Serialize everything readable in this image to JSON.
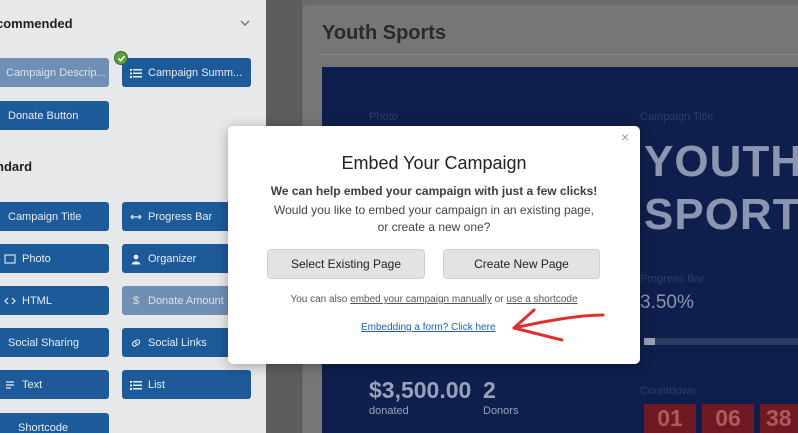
{
  "sidebar": {
    "recommended_label": "commended",
    "standard_label": "ndard",
    "recommended_items": [
      {
        "label": "Campaign Descrip...",
        "icon": "text-icon",
        "disabled": true
      },
      {
        "label": "Campaign Summ...",
        "icon": "list-icon",
        "disabled": false
      },
      {
        "label": "Donate Button",
        "icon": "button-icon",
        "disabled": false
      }
    ],
    "standard_items": [
      {
        "label": "Campaign Title",
        "icon": "title-icon"
      },
      {
        "label": "Progress Bar",
        "icon": "progress-icon"
      },
      {
        "label": "Photo",
        "icon": "photo-icon"
      },
      {
        "label": "Organizer",
        "icon": "user-icon"
      },
      {
        "label": "HTML",
        "icon": "code-icon"
      },
      {
        "label": "Donate Amount",
        "icon": "dollar-icon",
        "disabled": true
      },
      {
        "label": "Social Sharing",
        "icon": "share-icon"
      },
      {
        "label": "Social Links",
        "icon": "link-icon"
      },
      {
        "label": "Text",
        "icon": "text-icon"
      },
      {
        "label": "List",
        "icon": "list-icon"
      },
      {
        "label": "Shortcode",
        "icon": "shortcode-icon"
      }
    ]
  },
  "preview": {
    "title": "Youth Sports",
    "campaign_title_lines": [
      "YOUTH",
      "SPORT"
    ],
    "photo_label": "Photo",
    "campaign_title_label": "Campaign Title",
    "percent_label": "Progress Bar",
    "percent": "3.50%",
    "progress_fraction": 0.035,
    "amount": "$3,500.00",
    "amount_label": "donated",
    "donors": "2",
    "donors_label": "Donors",
    "countdown_label": "Countdown",
    "countdown": [
      "01",
      "06",
      "38"
    ]
  },
  "modal": {
    "close": "×",
    "title": "Embed Your Campaign",
    "text1": "We can help embed your campaign with just a few clicks!",
    "text2a": "Would you like to embed your campaign in an existing page,",
    "text2b": "or create a new one?",
    "btn_existing": "Select Existing Page",
    "btn_new": "Create New Page",
    "alt_prefix": "You can also",
    "alt_link1": "embed your campaign manually",
    "alt_or": "or",
    "alt_link2": "use a shortcode",
    "form_link": "Embedding a form? Click here"
  },
  "colors": {
    "sidebar_button": "#1d5a99",
    "campaign_bg": "#0f1f4d",
    "arrow": "#e0302a"
  }
}
